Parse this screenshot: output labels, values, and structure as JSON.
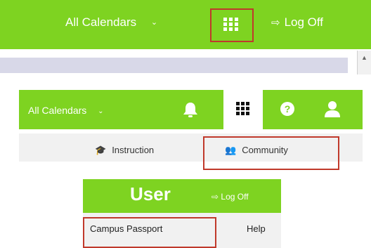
{
  "colors": {
    "accent_green": "#7ed321",
    "highlight_red": "#c0392b"
  },
  "panel_top": {
    "calendar_label": "All Calendars",
    "calendar_chevron": "⌄",
    "apps_icon": "grid-icon",
    "logoff_icon_glyph": "⇨",
    "logoff_label": "Log Off"
  },
  "panel_middle": {
    "calendar_label": "All Calendars",
    "calendar_chevron": "⌄",
    "help_glyph": "?",
    "tabs": [
      {
        "icon_glyph": "🎓",
        "label": "Instruction"
      },
      {
        "icon_glyph": "👥",
        "label": "Community"
      }
    ]
  },
  "panel_bottom": {
    "title": "User",
    "logoff_label": "Log Off",
    "logoff_icon_glyph": "⇨",
    "menu": [
      "Campus Passport",
      "Help"
    ]
  }
}
